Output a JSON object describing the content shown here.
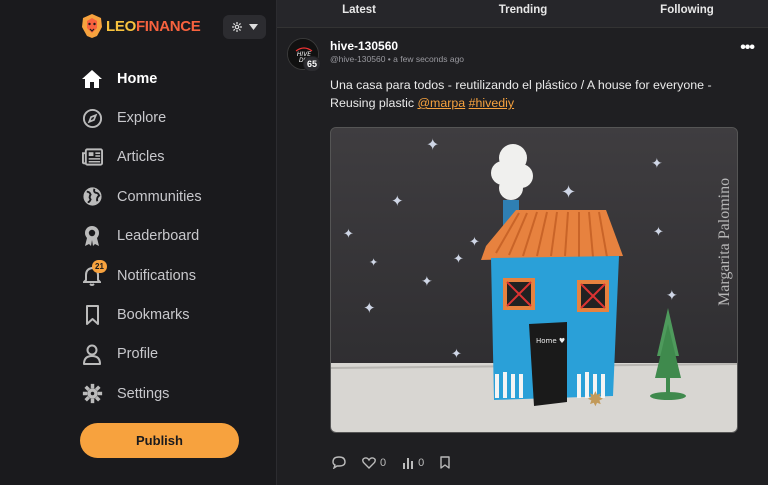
{
  "brand": {
    "logo_text_part1": "LEO",
    "logo_text_part2": "FINANCE"
  },
  "nav": {
    "items": [
      {
        "label": "Home",
        "icon": "home-icon"
      },
      {
        "label": "Explore",
        "icon": "compass-icon"
      },
      {
        "label": "Articles",
        "icon": "newspaper-icon"
      },
      {
        "label": "Communities",
        "icon": "globe-icon"
      },
      {
        "label": "Leaderboard",
        "icon": "award-icon"
      },
      {
        "label": "Notifications",
        "icon": "bell-icon",
        "badge": "21"
      },
      {
        "label": "Bookmarks",
        "icon": "bookmark-icon"
      },
      {
        "label": "Profile",
        "icon": "user-icon"
      },
      {
        "label": "Settings",
        "icon": "gear-icon"
      }
    ],
    "publish_label": "Publish"
  },
  "tabs": [
    "Latest",
    "Trending",
    "Following"
  ],
  "post": {
    "author": "hive-130560",
    "handle": "@hive-130560",
    "time": "a few seconds ago",
    "reputation": "65",
    "avatar_text": "HIVE DIY",
    "title_text": "Una casa para todos - reutilizando el plástico / A house for everyone - Reusing plastic ",
    "mention": "@marpa",
    "hashtag": "#hivediy",
    "image_watermark": "Margarita Palomino",
    "door_text": "Home ♥",
    "votes": "0",
    "reposts": "0"
  },
  "colors": {
    "accent": "#f7a23e",
    "background": "#1a1a1d",
    "panel": "#1f1f22"
  }
}
